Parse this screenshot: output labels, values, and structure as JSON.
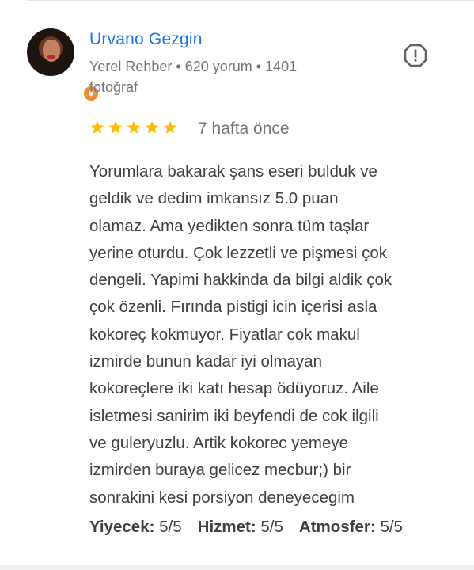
{
  "reviewer": {
    "name": "Urvano Gezgin",
    "meta": "Yerel Rehber • 620 yorum • 1401 fotoğraf"
  },
  "review": {
    "rating": 5,
    "date": "7 hafta önce",
    "lines": [
      "Yorumlara bakarak şans eseri bulduk ve",
      "geldik ve dedim imkansız 5.0 puan",
      "olamaz. Ama yedikten sonra tüm taşlar",
      "yerine oturdu. Çok lezzetli ve pişmesi çok",
      "dengeli. Yapimi hakkinda da bilgi aldik çok",
      "çok özenli. Fırında pistigi icin içerisi asla",
      "kokoreç kokmuyor. Fiyatlar cok makul",
      "izmirde bunun kadar iyi olmayan",
      "kokoreçlere iki katı hesap ödüyoruz. Aile",
      "isletmesi sanirim iki beyfendi de cok ilgili",
      "ve guleryuzlu. Artik kokorec yemeye",
      "izmirden buraya gelicez mecbur;) bir",
      "sonrakini kesi porsiyon deneyecegim"
    ]
  },
  "subratings": [
    {
      "label": "Yiyecek:",
      "value": "5/5"
    },
    {
      "label": "Hizmet:",
      "value": "5/5"
    },
    {
      "label": "Atmosfer:",
      "value": "5/5"
    }
  ],
  "icons": {
    "report": "report-icon",
    "star": "star-icon",
    "badge": "local-guide-badge-icon"
  },
  "colors": {
    "name": "#1a73e8",
    "star": "#fbbc04",
    "badge": "#f28b2f",
    "secondary_text": "#70757a"
  }
}
